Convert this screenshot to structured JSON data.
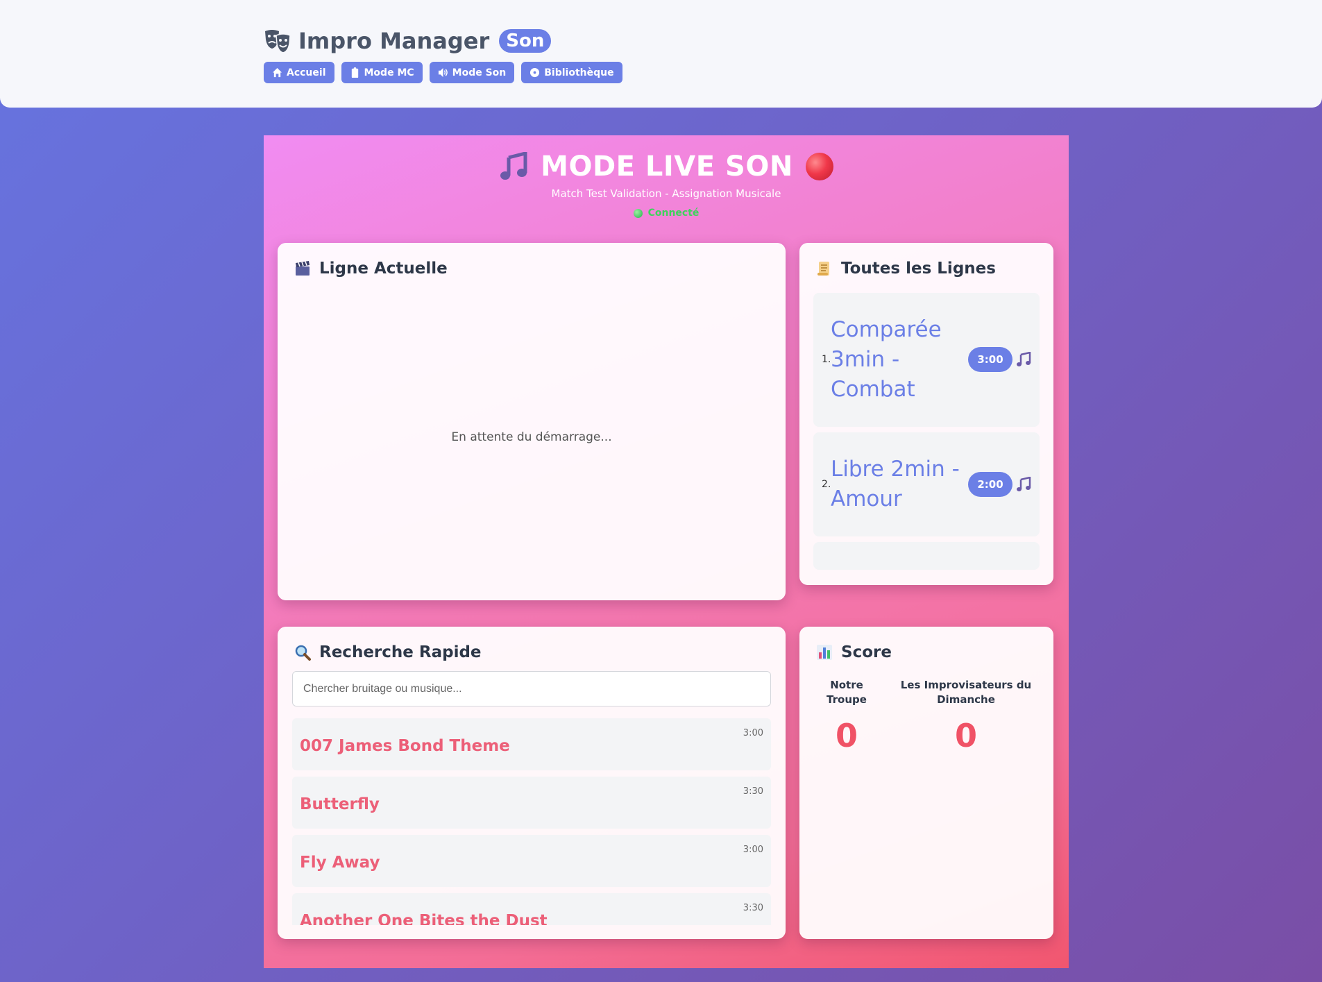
{
  "header": {
    "icon": "theater-masks-icon",
    "title": "Impro Manager",
    "badge": "Son",
    "nav": [
      {
        "label": "Accueil",
        "icon": "home-icon"
      },
      {
        "label": "Mode MC",
        "icon": "clipboard-icon"
      },
      {
        "label": "Mode Son",
        "icon": "speaker-icon"
      },
      {
        "label": "Bibliothèque",
        "icon": "disc-icon"
      }
    ]
  },
  "live": {
    "title": "MODE LIVE SON",
    "subtitle": "Match Test Validation - Assignation Musicale",
    "connection": "Connecté",
    "colors": {
      "accent": "#6b7fe6",
      "connected": "#3fd35c",
      "record": "#f0384a"
    }
  },
  "current": {
    "title": "Ligne Actuelle",
    "waiting": "En attente du démarrage..."
  },
  "lines": {
    "title": "Toutes les Lignes",
    "items": [
      {
        "num": "1.",
        "name": "Comparée 3min - Combat",
        "duration": "3:00"
      },
      {
        "num": "2.",
        "name": "Libre 2min - Amour",
        "duration": "2:00"
      }
    ]
  },
  "search": {
    "title": "Recherche Rapide",
    "placeholder": "Chercher bruitage ou musique...",
    "value": "",
    "results": [
      {
        "name": "007 James Bond Theme",
        "duration": "3:00"
      },
      {
        "name": "Butterfly",
        "duration": "3:30"
      },
      {
        "name": "Fly Away",
        "duration": "3:00"
      },
      {
        "name": "Another One Bites the Dust",
        "duration": "3:30"
      }
    ]
  },
  "score": {
    "title": "Score",
    "teams": [
      {
        "name": "Notre Troupe",
        "score": "0"
      },
      {
        "name": "Les Improvisateurs du Dimanche",
        "score": "0"
      }
    ]
  }
}
